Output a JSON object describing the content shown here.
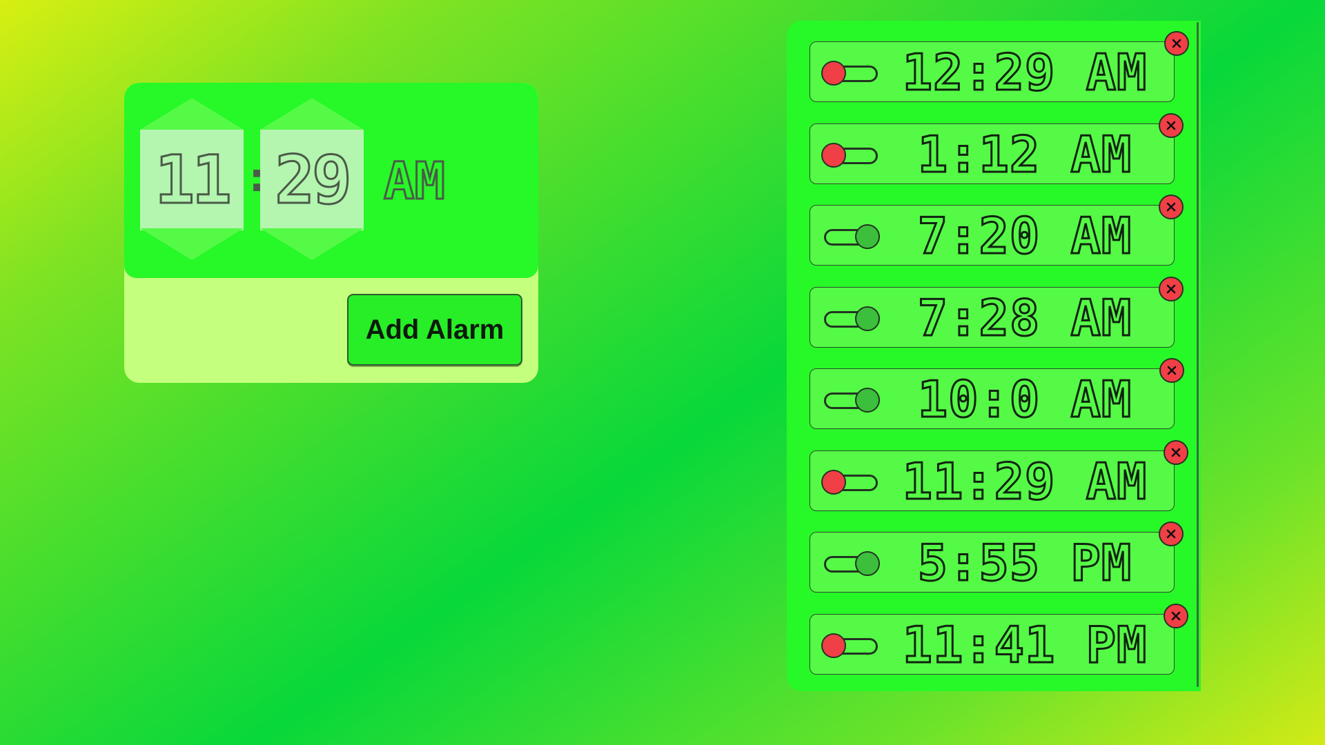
{
  "picker": {
    "hour": "11",
    "separator": ":",
    "minute": "29",
    "period": "AM",
    "add_button_label": "Add Alarm"
  },
  "colors": {
    "accent_green": "#27f827",
    "panel_light": "#c4ff7e",
    "toggle_off": "#f03f46",
    "toggle_on": "#3cbf3c"
  },
  "alarms": [
    {
      "time": "12:29 AM",
      "enabled": false
    },
    {
      "time": "1:12 AM",
      "enabled": false
    },
    {
      "time": "7:20 AM",
      "enabled": true
    },
    {
      "time": "7:28 AM",
      "enabled": true
    },
    {
      "time": "10:0 AM",
      "enabled": true
    },
    {
      "time": "11:29 AM",
      "enabled": false
    },
    {
      "time": "5:55 PM",
      "enabled": true
    },
    {
      "time": "11:41 PM",
      "enabled": false
    }
  ]
}
